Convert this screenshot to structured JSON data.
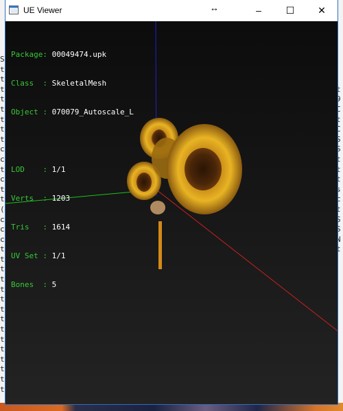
{
  "window": {
    "title": "UE Viewer",
    "buttons": {
      "minimize": "–",
      "maximize": "☐",
      "close": "✕"
    }
  },
  "info": {
    "lines1": [
      {
        "label": "Package: ",
        "value": "00049474.upk"
      },
      {
        "label": "Class  : ",
        "value": "SkeletalMesh"
      },
      {
        "label": "Object : ",
        "value": "070079_Autoscale_L"
      }
    ],
    "lines2": [
      {
        "label": "LOD    : ",
        "value": "1/1"
      },
      {
        "label": "Verts  : ",
        "value": "1203"
      },
      {
        "label": "Tris   : ",
        "value": "1614"
      },
      {
        "label": "UV Set : ",
        "value": "1/1"
      },
      {
        "label": "Bones  : ",
        "value": "5"
      }
    ]
  },
  "background": {
    "left_chars": "S\nt\nt\nt\nt\nt\nt\nt\nt\nc\nc\nt\nc\nt\nt\n(\nc\nc\nc\nt\nt\nt\nt\nt\nt\nt\nt\nt\nt\nt\nt\nt\nt\nt",
    "right_chars": "\n\n\nt\n9\nC\nt\nC\nS\nS\nt\nt\nt\ns\nc\nt\nS\nS\nN\nt\n\n\n\n\n\n\n\n\n\n"
  },
  "colors": {
    "label": "#38c838",
    "value": "#ffffff",
    "axis_x": "#cc2020",
    "axis_y": "#20c020",
    "axis_z": "#2020cc"
  }
}
